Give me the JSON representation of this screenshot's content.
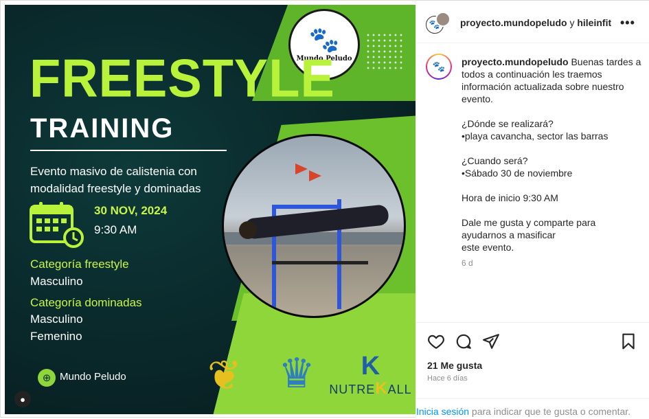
{
  "poster": {
    "title_line1": "FREESTYLE",
    "title_line2": "TRAINING",
    "subtitle": "Evento masivo de calistenia con modalidad freestyle y dominadas",
    "date": "30 NOV, 2024",
    "time": "9:30 AM",
    "category1_label": "Categoría freestyle",
    "category1_values": [
      "Masculino"
    ],
    "category2_label": "Categoría dominadas",
    "category2_values": [
      "Masculino",
      "Femenino"
    ],
    "brand": "Mundo Peludo",
    "logo_text": "Mundo Peludo",
    "sponsor3_text_a": "NUTRE",
    "sponsor3_text_b": "K",
    "sponsor3_text_c": "ALL",
    "colors": {
      "accent": "#b8f23a",
      "green": "#6cc02c",
      "dark": "#0a2a2c"
    }
  },
  "post": {
    "header_user": "proyecto.mundopeludo",
    "header_and": "y",
    "header_coauthor": "hileinfit",
    "caption_user": "proyecto.mundopeludo",
    "caption_text": "Buenas tardes a todos a continuación les traemos información actualizada sobre nuestro evento.\n\n¿Dónde se realizará?\n•playa cavancha, sector las barras\n\n¿Cuando será?\n•Sábado 30 de noviembre\n\nHora de inicio 9:30 AM\n\nDale me gusta y comparte para ayudarnos a masificar\neste evento.",
    "caption_age": "6 d",
    "likes": "21 Me gusta",
    "posted_ago": "Hace 6 días",
    "login_link": "Inicia sesión",
    "login_text": " para indicar que te gusta o comentar."
  },
  "icons": [
    "more-icon",
    "heart-icon",
    "comment-icon",
    "share-icon",
    "bookmark-icon",
    "calendar-icon",
    "globe-icon",
    "user-tag-icon"
  ]
}
